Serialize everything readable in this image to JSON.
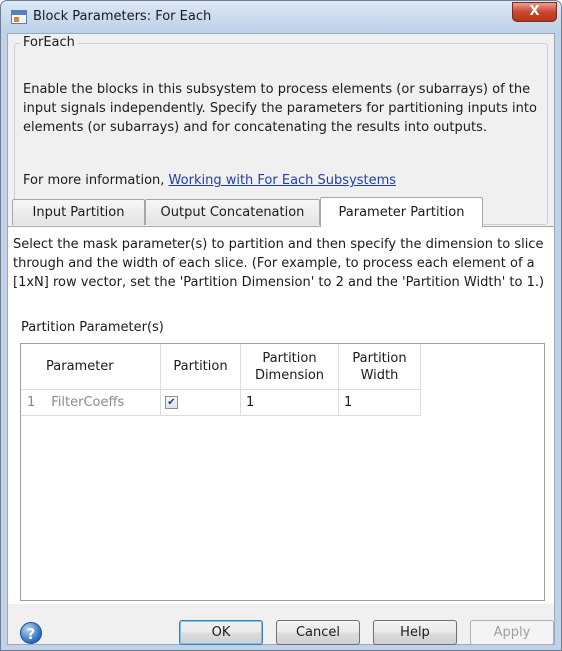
{
  "window": {
    "title": "Block Parameters: For Each",
    "close_symbol": "X"
  },
  "group": {
    "title": "ForEach",
    "description": "Enable the blocks in this subsystem to process elements (or subarrays) of the input signals independently. Specify the parameters for partitioning inputs into elements (or subarrays) and for concatenating the results into outputs.",
    "info_prefix": "For more information, ",
    "info_link": "Working with For Each Subsystems"
  },
  "tabs": [
    {
      "label": "Input Partition",
      "active": false
    },
    {
      "label": "Output Concatenation",
      "active": false
    },
    {
      "label": "Parameter Partition",
      "active": true
    }
  ],
  "panel": {
    "description": "Select the mask parameter(s) to partition and then specify the dimension to slice through and the width of each slice. (For example, to process each element of a [1xN] row vector, set the 'Partition Dimension' to 2 and the 'Partition Width' to 1.)",
    "section_label": "Partition Parameter(s)"
  },
  "table": {
    "headers": [
      "Parameter",
      "Partition",
      "Partition Dimension",
      "Partition Width"
    ],
    "rows": [
      {
        "index": "1",
        "parameter": "FilterCoeffs",
        "partition_checked": true,
        "dimension": "1",
        "width": "1"
      }
    ]
  },
  "buttons": {
    "ok": "OK",
    "cancel": "Cancel",
    "help": "Help",
    "apply": "Apply",
    "help_icon_symbol": "?"
  },
  "icons": {
    "app": "simulink-block-icon",
    "help": "help-question-icon",
    "check": "checkmark-icon"
  },
  "colors": {
    "link": "#1f3fa6",
    "close": "#c9462e",
    "help_icon": "#2b6bbf"
  }
}
